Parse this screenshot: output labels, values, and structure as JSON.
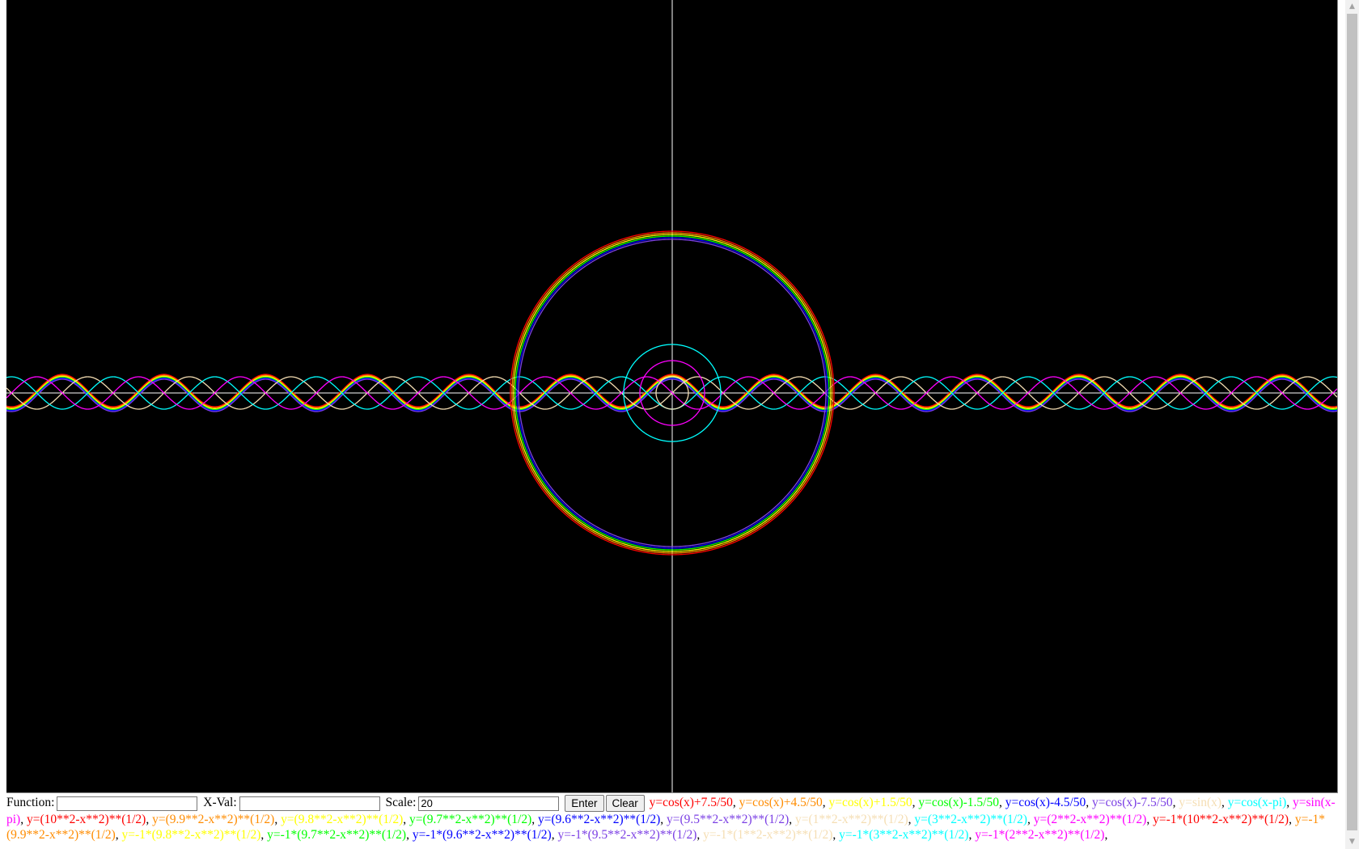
{
  "controls": {
    "function_label": "Function:",
    "function_value": "",
    "xval_label": "X-Val:",
    "xval_value": "",
    "scale_label": "Scale:",
    "scale_value": "20",
    "enter_label": "Enter",
    "clear_label": "Clear"
  },
  "graph": {
    "background": "#000000",
    "axis_color": "#ffffff",
    "scale": 20
  },
  "equations": [
    {
      "text": "y=cos(x)+7.5/50",
      "color": "#ff0000",
      "kind": "cos_shift",
      "shift": 0.15
    },
    {
      "text": "y=cos(x)+4.5/50",
      "color": "#ff8c00",
      "kind": "cos_shift",
      "shift": 0.09
    },
    {
      "text": "y=cos(x)+1.5/50",
      "color": "#ffff00",
      "kind": "cos_shift",
      "shift": 0.03
    },
    {
      "text": "y=cos(x)-1.5/50",
      "color": "#00ff00",
      "kind": "cos_shift",
      "shift": -0.03
    },
    {
      "text": "y=cos(x)-4.5/50",
      "color": "#0000ff",
      "kind": "cos_shift",
      "shift": -0.09
    },
    {
      "text": "y=cos(x)-7.5/50",
      "color": "#7b3fe4",
      "kind": "cos_shift",
      "shift": -0.15
    },
    {
      "text": "y=sin(x)",
      "color": "#f5deb3",
      "kind": "sin"
    },
    {
      "text": "y=cos(x-pi)",
      "color": "#00ffff",
      "kind": "negcos"
    },
    {
      "text": "y=sin(x-pi)",
      "color": "#ff00ff",
      "kind": "negsin"
    },
    {
      "text": "y=(10**2-x**2)**(1/2)",
      "color": "#ff0000",
      "kind": "circle_top",
      "r": 10
    },
    {
      "text": "y=(9.9**2-x**2)**(1/2)",
      "color": "#ff8c00",
      "kind": "circle_top",
      "r": 9.9
    },
    {
      "text": "y=(9.8**2-x**2)**(1/2)",
      "color": "#ffff00",
      "kind": "circle_top",
      "r": 9.8
    },
    {
      "text": "y=(9.7**2-x**2)**(1/2)",
      "color": "#00ff00",
      "kind": "circle_top",
      "r": 9.7
    },
    {
      "text": "y=(9.6**2-x**2)**(1/2)",
      "color": "#0000ff",
      "kind": "circle_top",
      "r": 9.6
    },
    {
      "text": "y=(9.5**2-x**2)**(1/2)",
      "color": "#7b3fe4",
      "kind": "circle_top",
      "r": 9.5
    },
    {
      "text": "y=(1**2-x**2)**(1/2)",
      "color": "#f5deb3",
      "kind": "circle_top",
      "r": 1
    },
    {
      "text": "y=(3**2-x**2)**(1/2)",
      "color": "#00ffff",
      "kind": "circle_top",
      "r": 3
    },
    {
      "text": "y=(2**2-x**2)**(1/2)",
      "color": "#ff00ff",
      "kind": "circle_top",
      "r": 2
    },
    {
      "text": "y=-1*(10**2-x**2)**(1/2)",
      "color": "#ff0000",
      "kind": "circle_bottom",
      "r": 10
    },
    {
      "text": "y=-1*(9.9**2-x**2)**(1/2)",
      "color": "#ff8c00",
      "kind": "circle_bottom",
      "r": 9.9
    },
    {
      "text": "y=-1*(9.8**2-x**2)**(1/2)",
      "color": "#ffff00",
      "kind": "circle_bottom",
      "r": 9.8
    },
    {
      "text": "y=-1*(9.7**2-x**2)**(1/2)",
      "color": "#00ff00",
      "kind": "circle_bottom",
      "r": 9.7
    },
    {
      "text": "y=-1*(9.6**2-x**2)**(1/2)",
      "color": "#0000ff",
      "kind": "circle_bottom",
      "r": 9.6
    },
    {
      "text": "y=-1*(9.5**2-x**2)**(1/2)",
      "color": "#7b3fe4",
      "kind": "circle_bottom",
      "r": 9.5
    },
    {
      "text": "y=-1*(1**2-x**2)**(1/2)",
      "color": "#f5deb3",
      "kind": "circle_bottom",
      "r": 1
    },
    {
      "text": "y=-1*(3**2-x**2)**(1/2)",
      "color": "#00ffff",
      "kind": "circle_bottom",
      "r": 3
    },
    {
      "text": "y=-1*(2**2-x**2)**(1/2)",
      "color": "#ff00ff",
      "kind": "circle_bottom",
      "r": 2
    }
  ]
}
